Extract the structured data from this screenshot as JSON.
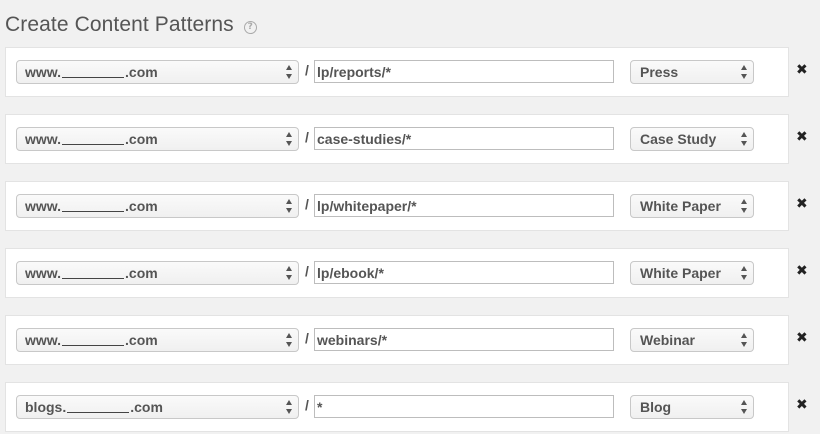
{
  "header": {
    "title": "Create Content Patterns",
    "help_icon": "question-circle-icon"
  },
  "patterns": [
    {
      "domain_prefix": "www.",
      "domain_suffix": ".com",
      "path": "lp/reports/*",
      "type": "Press"
    },
    {
      "domain_prefix": "www.",
      "domain_suffix": ".com",
      "path": "case-studies/*",
      "type": "Case Study"
    },
    {
      "domain_prefix": "www.",
      "domain_suffix": ".com",
      "path": "lp/whitepaper/*",
      "type": "White Paper"
    },
    {
      "domain_prefix": "www.",
      "domain_suffix": ".com",
      "path": "lp/ebook/*",
      "type": "White Paper"
    },
    {
      "domain_prefix": "www.",
      "domain_suffix": ".com",
      "path": "webinars/*",
      "type": "Webinar"
    },
    {
      "domain_prefix": "blogs.",
      "domain_suffix": ".com",
      "path": "*",
      "type": "Blog"
    }
  ],
  "separator": "/",
  "remove_icon": "close-x-icon"
}
